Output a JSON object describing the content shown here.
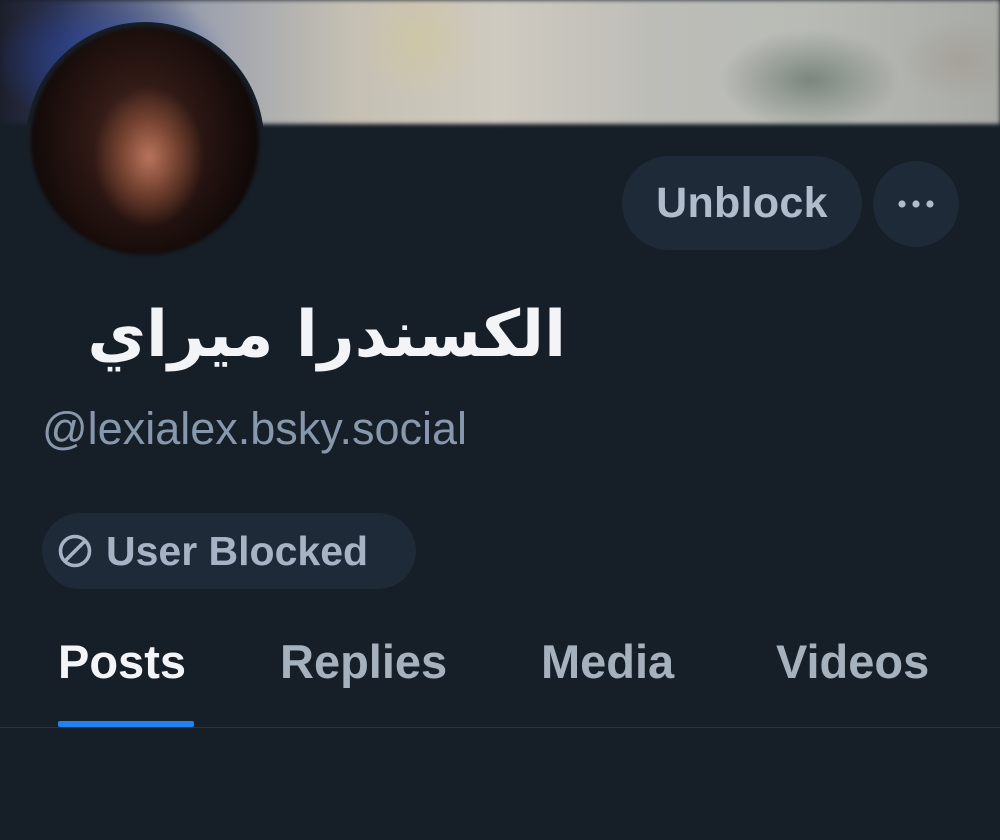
{
  "profile": {
    "display_name": "الكسندرا ميراي",
    "handle": "@lexialex.bsky.social"
  },
  "actions": {
    "unblock_label": "Unblock",
    "more_label": "···"
  },
  "status": {
    "blocked_label": "User Blocked",
    "blocked_icon": "block-icon"
  },
  "tabs": [
    {
      "label": "Posts",
      "active": true
    },
    {
      "label": "Replies",
      "active": false
    },
    {
      "label": "Media",
      "active": false
    },
    {
      "label": "Videos",
      "active": false
    }
  ],
  "colors": {
    "background": "#161e27",
    "button_bg": "#1e2a37",
    "accent": "#1e83f0",
    "primary_text": "#f2f4f7",
    "secondary_text": "#8898ac"
  }
}
